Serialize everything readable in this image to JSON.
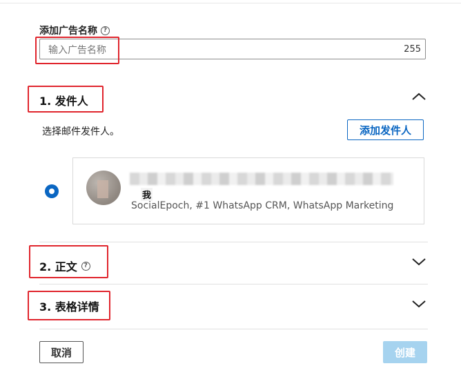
{
  "form": {
    "ad_name_label": "添加广告名称",
    "ad_name_placeholder": "输入广告名称",
    "ad_name_value": "",
    "char_limit": "255"
  },
  "sections": [
    {
      "title": "1. 发件人",
      "expanded": true,
      "has_help": false
    },
    {
      "title": "2. 正文",
      "expanded": false,
      "has_help": true
    },
    {
      "title": "3. 表格详情",
      "expanded": false,
      "has_help": false
    }
  ],
  "sender": {
    "hint": "选择邮件发件人。",
    "add_button": "添加发件人",
    "selected": true,
    "me_tag": "我",
    "headline": "SocialEpoch, #1 WhatsApp CRM, WhatsApp Marketing"
  },
  "footer": {
    "cancel": "取消",
    "create": "创建"
  },
  "colors": {
    "primary": "#0a66c2",
    "disabled_button": "#a6d3ef",
    "highlight_box": "#e0242c"
  },
  "icons": {
    "help": "question-circle-icon",
    "collapse": "chevron-up-icon",
    "expand": "chevron-down-icon",
    "radio": "radio-selected-icon"
  }
}
